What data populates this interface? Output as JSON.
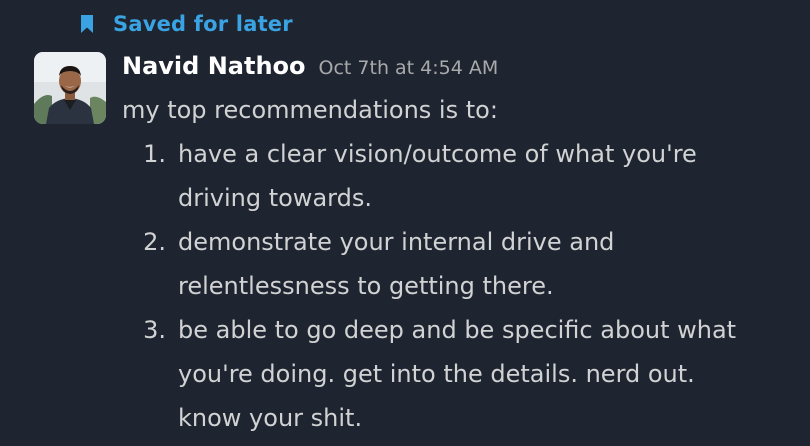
{
  "saved_banner": {
    "label": "Saved for later",
    "icon": "bookmark-icon",
    "color": "#3aa3e3"
  },
  "message": {
    "author": "Navid Nathoo",
    "timestamp": "Oct 7th at 4:54 AM",
    "avatar": "avatar-photo",
    "intro": "my top recommendations is to:",
    "recommendations": [
      {
        "number": "1.",
        "text": "have a clear vision/outcome of what you're driving towards."
      },
      {
        "number": "2.",
        "text": "demonstrate your internal drive and relentlessness to getting there."
      },
      {
        "number": "3.",
        "text": "be able to go deep and be specific about what you're doing. get into the details. nerd out. know your shit."
      }
    ]
  }
}
